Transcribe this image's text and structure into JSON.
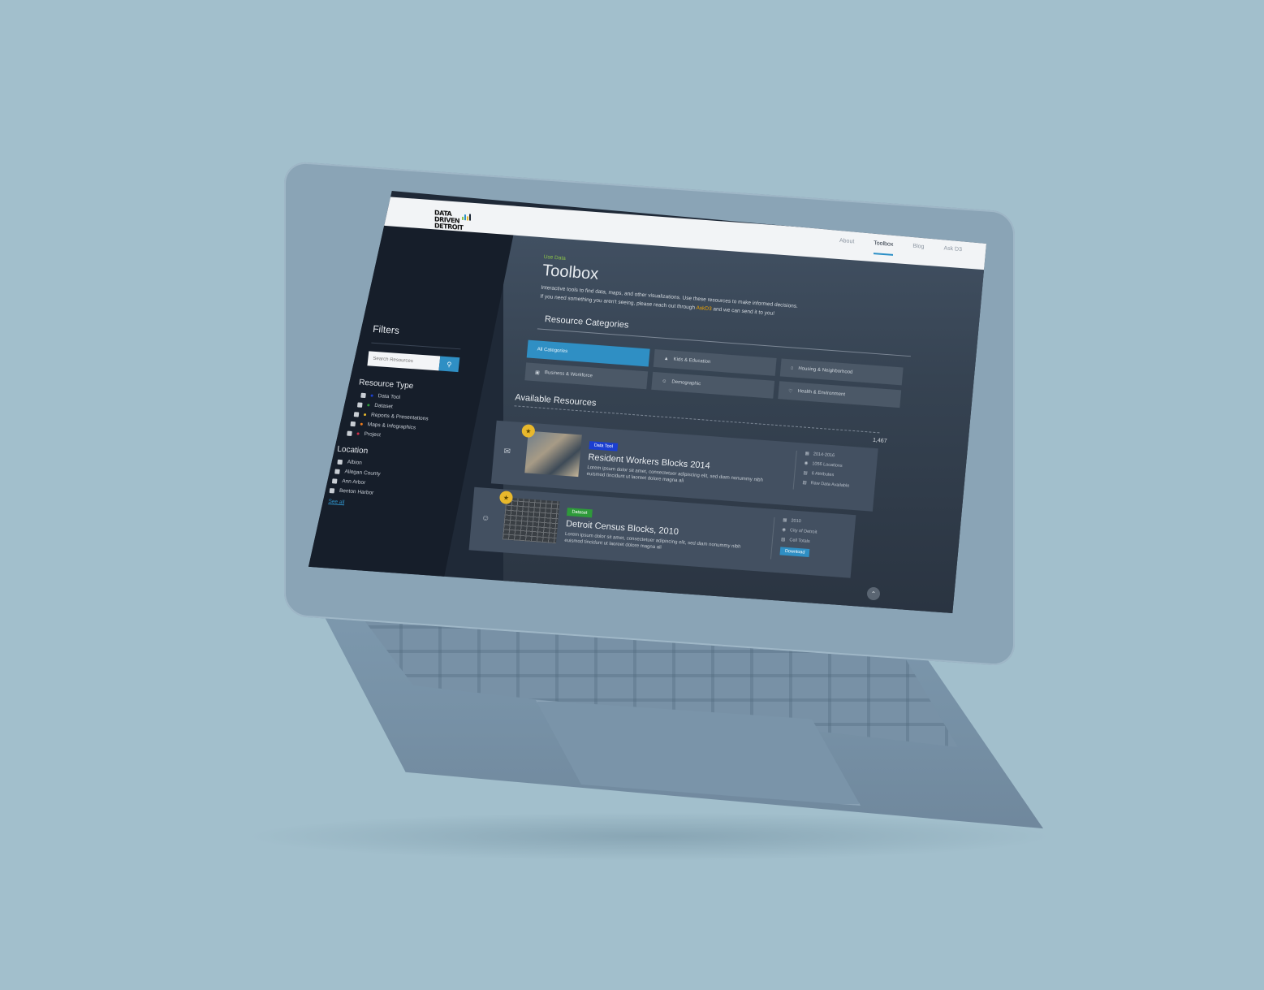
{
  "brand": {
    "logo_lines": [
      "DATA",
      "DRIVEN",
      "DETROIT"
    ],
    "logo_bar_colors": [
      "#8bc34a",
      "#2f8fc4",
      "#e8b82c",
      "#1f2937"
    ]
  },
  "nav": {
    "items": [
      {
        "label": "About",
        "active": false
      },
      {
        "label": "Toolbox",
        "active": true
      },
      {
        "label": "Blog",
        "active": false
      },
      {
        "label": "Ask D3",
        "active": false
      }
    ]
  },
  "sidebar": {
    "title": "Filters",
    "search_placeholder": "Search Resources",
    "search_icon": "search-icon",
    "resource_type": {
      "title": "Resource Type",
      "items": [
        {
          "label": "Data Tool",
          "color": "#1b3fd1"
        },
        {
          "label": "Dataset",
          "color": "#2e9a3a"
        },
        {
          "label": "Reports & Presentations",
          "color": "#e8b82c"
        },
        {
          "label": "Maps & Infographics",
          "color": "#f07c1a"
        },
        {
          "label": "Project",
          "color": "#d0304a"
        }
      ]
    },
    "location": {
      "title": "Location",
      "items": [
        "Albion",
        "Allegan County",
        "Ann Arbor",
        "Benton Harbor"
      ],
      "see_all": "See all"
    }
  },
  "main": {
    "eyebrow": "Use Data",
    "title": "Toolbox",
    "intro_1": "Interactive tools to find data, maps, and other visualizations. Use these resources to make informed decisions.",
    "intro_2_pre": "If you need something you aren't seeing, please reach out through ",
    "intro_2_link": "AskD3",
    "intro_2_post": " and we can send it to you!",
    "categories_title": "Resource Categories",
    "categories": [
      {
        "label": "All Categories",
        "icon": "",
        "active": true
      },
      {
        "label": "Kids & Education",
        "icon": "graduation-cap-icon",
        "active": false
      },
      {
        "label": "Housing & Neighborhood",
        "icon": "house-icon",
        "active": false
      },
      {
        "label": "Business & Workforce",
        "icon": "briefcase-icon",
        "active": false
      },
      {
        "label": "Demographic",
        "icon": "person-icon",
        "active": false
      },
      {
        "label": "Health & Environment",
        "icon": "heart-icon",
        "active": false
      }
    ],
    "available_title": "Available Resources",
    "count": "1,467",
    "resources": [
      {
        "tag": "Data Tool",
        "tag_color": "#1b3fd1",
        "title": "Resident Workers Blocks 2014",
        "description": "Lorem ipsum dolor sit amet, consectetuer adipiscing elit, sed diam nonummy nibh euismod tincidunt ut laoreet dolore magna ali",
        "meta": [
          "2014-2016",
          "1056 Locations",
          "6 Attributes",
          "Raw Data Available"
        ]
      },
      {
        "tag": "Dataset",
        "tag_color": "#2e9a3a",
        "title": "Detroit Census Blocks, 2010",
        "description": "Lorem ipsum dolor sit amet, consectetuer adipiscing elit, sed diam nonummy nibh euismod tincidunt ut laoreet dolore magna ali",
        "meta": [
          "2010",
          "City of Detroit",
          "Cell Totals"
        ],
        "button": "Download"
      }
    ]
  }
}
